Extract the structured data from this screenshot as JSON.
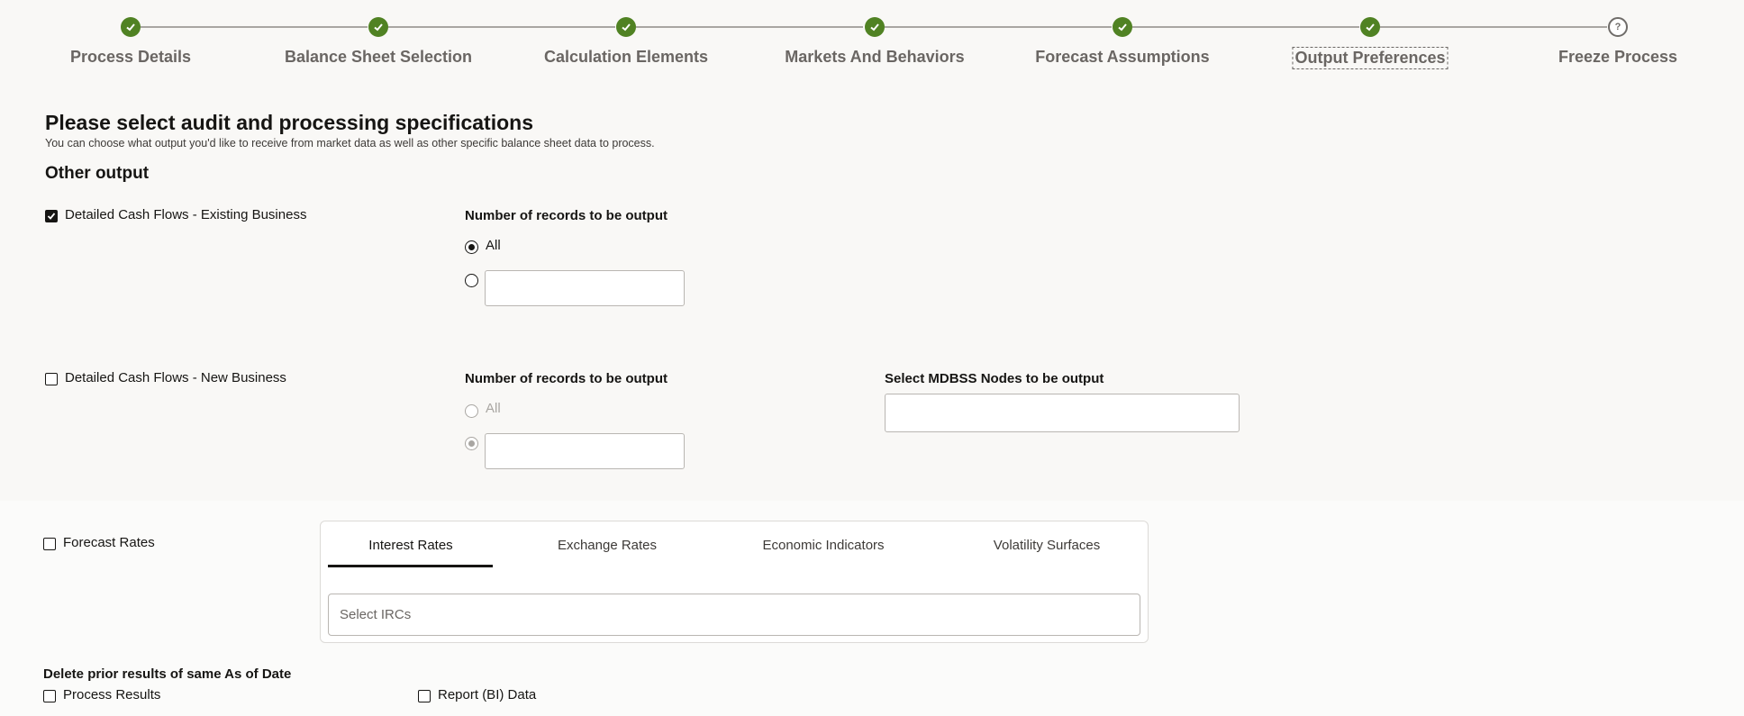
{
  "train": {
    "steps": [
      {
        "label": "Process Details",
        "status": "done"
      },
      {
        "label": "Balance Sheet Selection",
        "status": "done"
      },
      {
        "label": "Calculation Elements",
        "status": "done"
      },
      {
        "label": "Markets And Behaviors",
        "status": "done"
      },
      {
        "label": "Forecast Assumptions",
        "status": "done"
      },
      {
        "label": "Output Preferences",
        "status": "current"
      },
      {
        "label": "Freeze Process",
        "status": "pending",
        "marker": "?"
      }
    ]
  },
  "header": {
    "title": "Please select audit and processing specifications",
    "subtitle": "You can choose what output you'd like to receive from market data as well as other specific balance sheet data to process."
  },
  "other_output": {
    "title": "Other output",
    "existing": {
      "label": "Detailed Cash Flows - Existing Business",
      "checked": true,
      "records_label": "Number of records to be output",
      "option_all": "All",
      "selected": "All",
      "count_value": ""
    },
    "new_business": {
      "label": "Detailed Cash Flows - New Business",
      "checked": false,
      "records_label": "Number of records to be output",
      "option_all": "All",
      "selected": "count",
      "count_value": "",
      "mdbss_label": "Select MDBSS Nodes to be output",
      "mdbss_value": ""
    },
    "forecast_rates": {
      "label": "Forecast Rates",
      "checked": false,
      "tabs": [
        "Interest Rates",
        "Exchange Rates",
        "Economic Indicators",
        "Volatility Surfaces"
      ],
      "active_tab": "Interest Rates",
      "irc_placeholder": "Select IRCs"
    },
    "delete_prior": {
      "title": "Delete prior results of same As of Date",
      "process_results": "Process Results",
      "report_data": "Report (BI) Data"
    }
  },
  "colors": {
    "accent_green": "#508223",
    "text": "#161513",
    "muted": "#6a6663",
    "background": "#f9f8f6"
  }
}
